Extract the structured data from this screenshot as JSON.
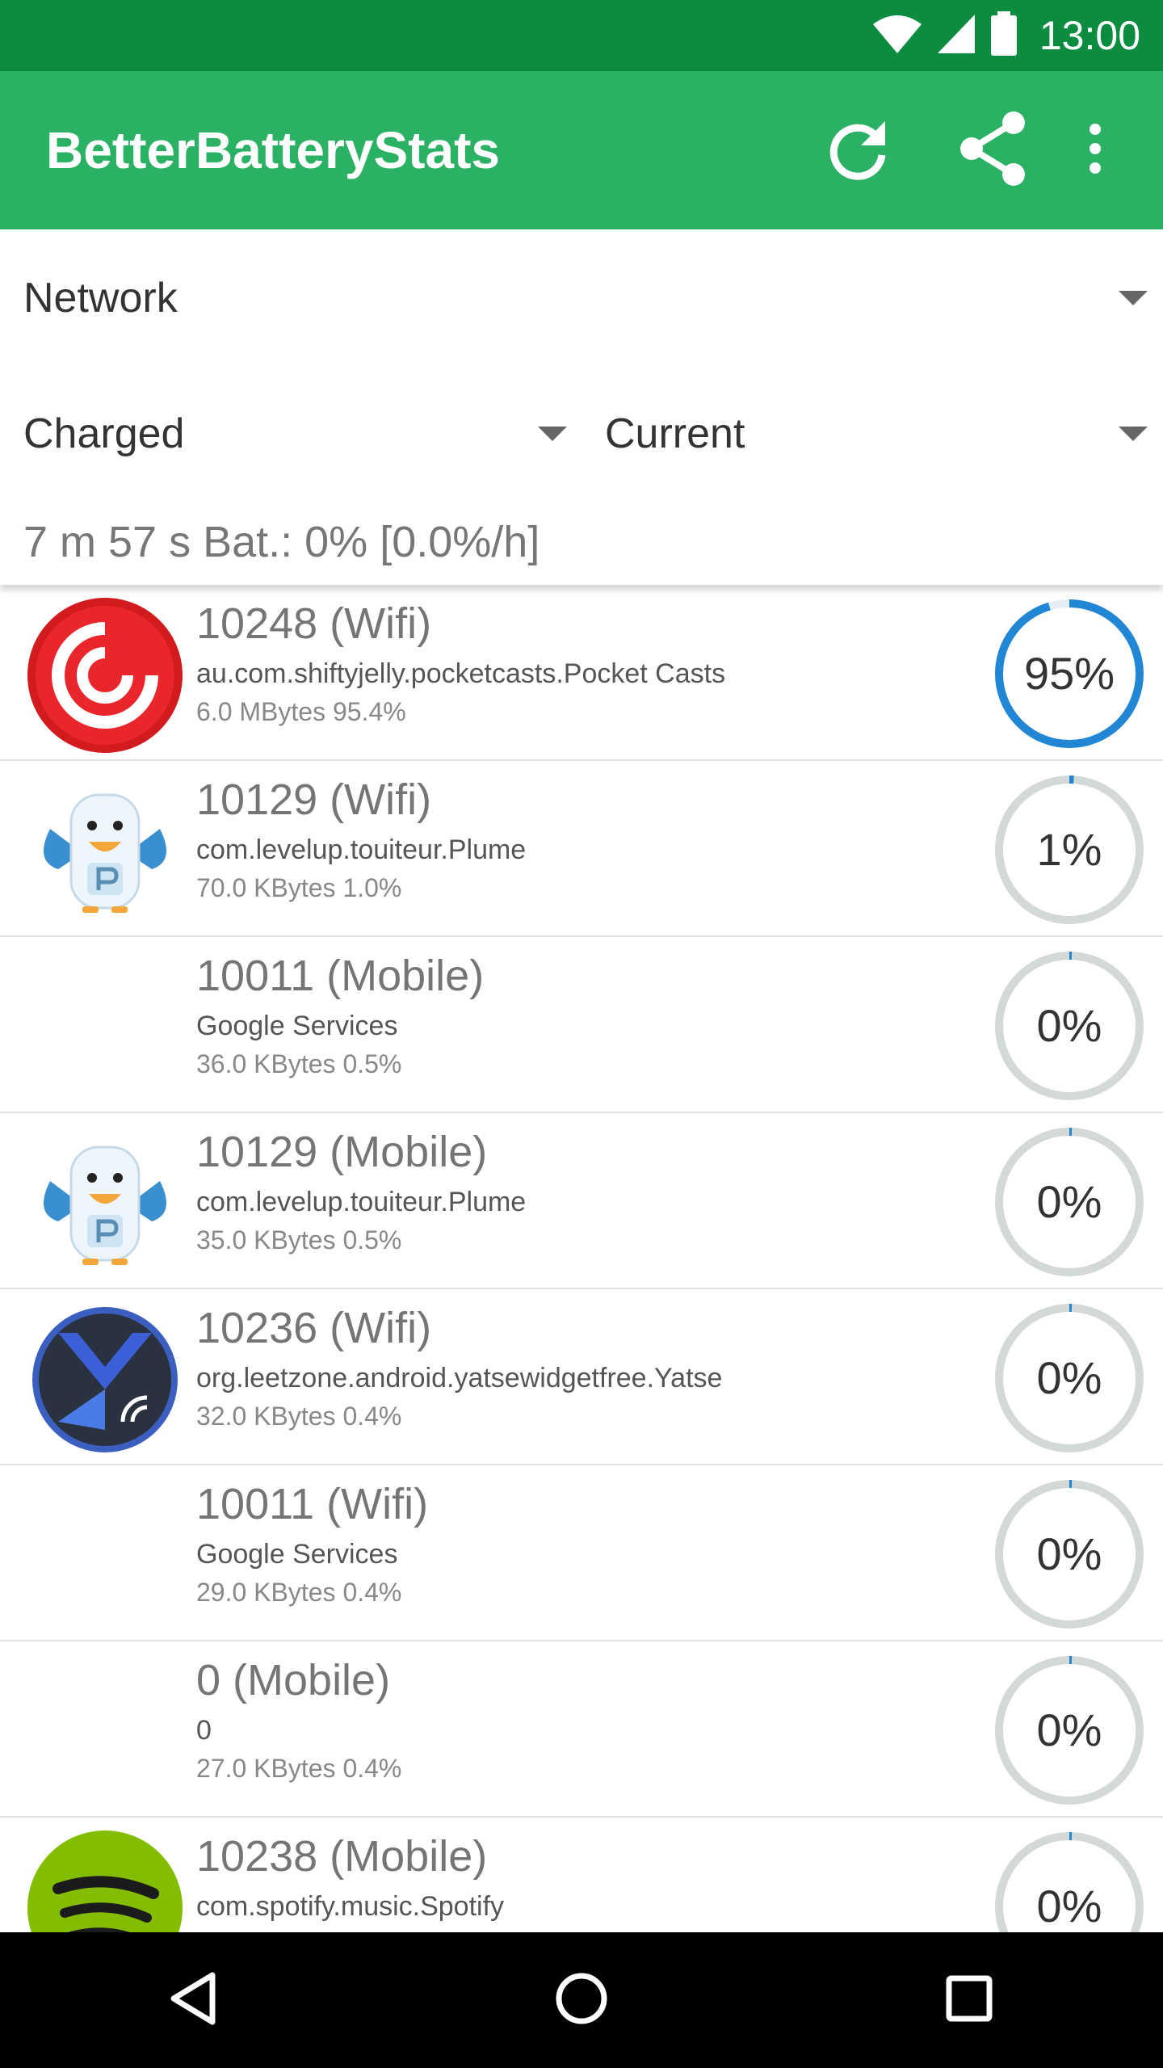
{
  "status_bar": {
    "time": "13:00"
  },
  "app_bar": {
    "title": "BetterBatteryStats",
    "icons": [
      "refresh-icon",
      "share-icon",
      "overflow-menu-icon"
    ]
  },
  "filters": {
    "stat_type": "Network",
    "reference_from": "Charged",
    "reference_to": "Current",
    "summary": "7 m 57 s  Bat.: 0% [0.0%/h]"
  },
  "colors": {
    "status_bar": "#0b8c3f",
    "app_bar": "#2bb164",
    "gauge_active": "#2186d4",
    "gauge_track": "#d3d8d8"
  },
  "rows": [
    {
      "title": "10248 (Wifi)",
      "package": "au.com.shiftyjelly.pocketcasts.Pocket Casts",
      "detail": "6.0 MBytes 95.4%",
      "percent_label": "95%",
      "percent": 95.4,
      "icon": "pocket-casts-icon"
    },
    {
      "title": "10129 (Wifi)",
      "package": "com.levelup.touiteur.Plume",
      "detail": "70.0 KBytes 1.0%",
      "percent_label": "1%",
      "percent": 1.0,
      "icon": "plume-icon"
    },
    {
      "title": "10011 (Mobile)",
      "package": "Google Services",
      "detail": "36.0 KBytes 0.5%",
      "percent_label": "0%",
      "percent": 0.5,
      "icon": ""
    },
    {
      "title": "10129 (Mobile)",
      "package": "com.levelup.touiteur.Plume",
      "detail": "35.0 KBytes 0.5%",
      "percent_label": "0%",
      "percent": 0.5,
      "icon": "plume-icon"
    },
    {
      "title": "10236 (Wifi)",
      "package": "org.leetzone.android.yatsewidgetfree.Yatse",
      "detail": "32.0 KBytes 0.4%",
      "percent_label": "0%",
      "percent": 0.4,
      "icon": "yatse-icon"
    },
    {
      "title": "10011 (Wifi)",
      "package": "Google Services",
      "detail": "29.0 KBytes 0.4%",
      "percent_label": "0%",
      "percent": 0.4,
      "icon": ""
    },
    {
      "title": "0 (Mobile)",
      "package": "0",
      "detail": "27.0 KBytes 0.4%",
      "percent_label": "0%",
      "percent": 0.4,
      "icon": ""
    },
    {
      "title": "10238 (Mobile)",
      "package": "com.spotify.music.Spotify",
      "detail": "",
      "percent_label": "0%",
      "percent": 0.3,
      "icon": "spotify-icon"
    }
  ],
  "nav_bar": {
    "icons": [
      "back-icon",
      "home-icon",
      "recents-icon"
    ]
  }
}
